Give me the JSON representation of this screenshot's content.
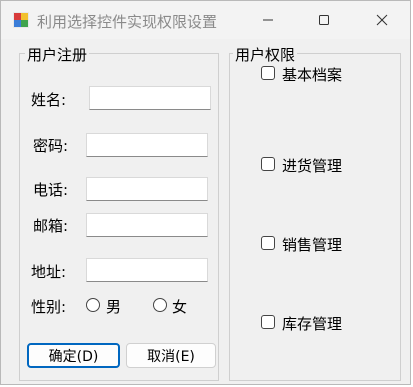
{
  "window": {
    "title": "利用选择控件实现权限设置"
  },
  "user_reg": {
    "legend": "用户注册",
    "name_label": "姓名:",
    "password_label": "密码:",
    "phone_label": "电话:",
    "email_label": "邮箱:",
    "address_label": "地址:",
    "gender_label": "性别:",
    "male_label": "男",
    "female_label": "女",
    "ok_button": "确定(D)",
    "cancel_button": "取消(E)"
  },
  "permissions": {
    "legend": "用户权限",
    "items": [
      {
        "label": "基本档案",
        "checked": false
      },
      {
        "label": "进货管理",
        "checked": false
      },
      {
        "label": "销售管理",
        "checked": false
      },
      {
        "label": "库存管理",
        "checked": false
      }
    ]
  }
}
